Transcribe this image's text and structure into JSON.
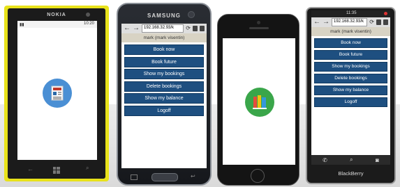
{
  "phones": [
    {
      "model": "nokia-lumia",
      "brand": "NOKIA",
      "status_time": "10:20",
      "splash_icon": "newspaper-icon",
      "nav_icons": [
        "back-arrow-icon",
        "windows-logo-icon",
        "search-icon"
      ]
    },
    {
      "model": "samsung-galaxy",
      "brand": "SAMSUNG",
      "url": "192.168.32.93/k",
      "user_label": "mark (mark visentin)",
      "menu": [
        "Book now",
        "Book future",
        "Show my bookings",
        "Delete bookings",
        "Show my balance",
        "Logoff"
      ]
    },
    {
      "model": "iphone",
      "splash_icon": "books-icon"
    },
    {
      "model": "blackberry",
      "brand": "BlackBerry",
      "status_time": "11:35",
      "url": "192.168.32.93/k",
      "user_label": "mark (mark visentin)",
      "menu": [
        "Book now",
        "Book future",
        "Show my bookings",
        "Delete bookings",
        "Show my balance",
        "Logoff"
      ],
      "dock_icons": [
        "phone-icon",
        "search-icon",
        "camera-icon"
      ]
    }
  ],
  "colors": {
    "nokia_body": "#e8e21a",
    "menu_button": "#1e4f80",
    "nokia_icon_bg": "#4a8fd4",
    "iphone_icon_bg": "#3aa64a"
  }
}
